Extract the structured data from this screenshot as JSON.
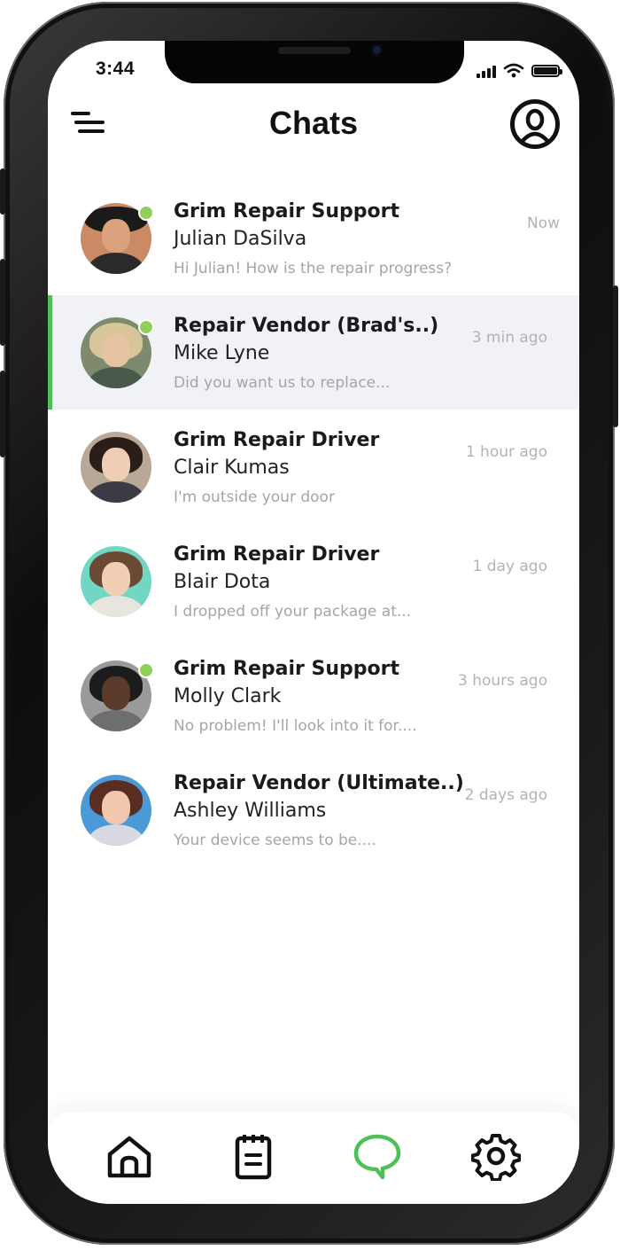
{
  "status_bar": {
    "time": "3:44"
  },
  "header": {
    "title": "Chats"
  },
  "chats": [
    {
      "title": "Grim Repair Support",
      "name": "Julian DaSilva",
      "message": "Hi Julian! How is the repair progress?",
      "time": "Now",
      "online": true,
      "active": false
    },
    {
      "title": "Repair Vendor (Brad's..)",
      "name": "Mike Lyne",
      "message": "Did you want us to replace...",
      "time": "3 min ago",
      "online": true,
      "active": true
    },
    {
      "title": "Grim Repair Driver",
      "name": "Clair Kumas",
      "message": "I'm outside your door",
      "time": "1 hour ago",
      "online": false,
      "active": false
    },
    {
      "title": "Grim Repair Driver",
      "name": "Blair Dota",
      "message": "I dropped off your package at...",
      "time": "1 day ago",
      "online": false,
      "active": false
    },
    {
      "title": "Grim Repair Support",
      "name": "Molly Clark",
      "message": "No problem! I'll look into it for....",
      "time": "3 hours ago",
      "online": true,
      "active": false
    },
    {
      "title": "Repair Vendor (Ultimate..)",
      "name": "Ashley Williams",
      "message": "Your device seems to be....",
      "time": "2 days ago",
      "online": false,
      "active": false
    }
  ],
  "tab_bar": {
    "tabs": [
      {
        "icon": "home-icon",
        "active": false
      },
      {
        "icon": "notepad-icon",
        "active": false
      },
      {
        "icon": "chat-bubble-icon",
        "active": true
      },
      {
        "icon": "gear-icon",
        "active": false
      }
    ]
  },
  "colors": {
    "accent": "#4fbf5a",
    "online": "#8fcf5a",
    "active_row": "#f1f2f6",
    "muted_text": "#a5a5a5"
  }
}
